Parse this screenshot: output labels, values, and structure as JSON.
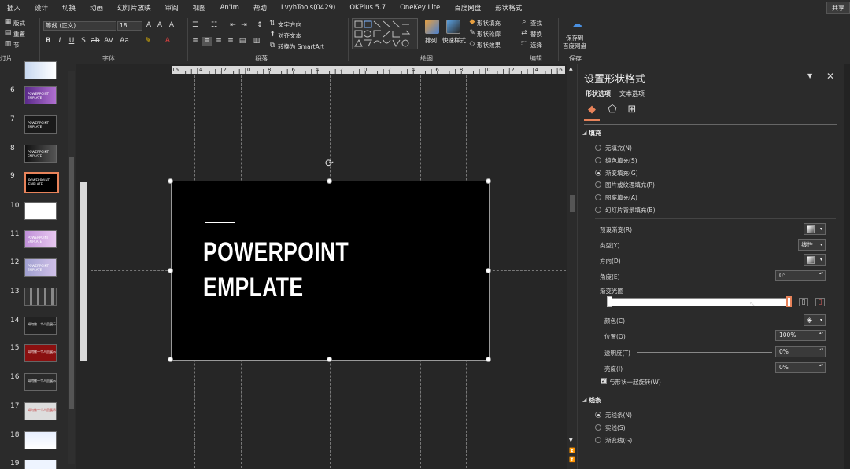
{
  "menu": {
    "items": [
      "插入",
      "设计",
      "切换",
      "动画",
      "幻灯片放映",
      "审阅",
      "视图",
      "An'Im",
      "帮助",
      "LvyhTools(0429)",
      "OKPlus 5.7",
      "OneKey Lite",
      "百度网盘",
      "形状格式"
    ],
    "share_label": "共享"
  },
  "ribbon": {
    "slides_group": {
      "layout_label": "版式",
      "reset_label": "重置",
      "section_label": "节",
      "group_label": "灯片"
    },
    "font_group": {
      "font_name": "等线 (正文)",
      "font_size": "18",
      "group_label": "字体"
    },
    "paragraph_group": {
      "text_direction_label": "文字方向",
      "align_text_label": "对齐文本",
      "smartart_label": "转换为 SmartArt",
      "group_label": "段落"
    },
    "drawing_group": {
      "arrange_label": "排列",
      "quick_styles_label": "快速样式",
      "shape_fill_label": "形状填充",
      "shape_outline_label": "形状轮廓",
      "shape_effects_label": "形状效果",
      "group_label": "绘图"
    },
    "editing_group": {
      "find_label": "查找",
      "replace_label": "替换",
      "select_label": "选择",
      "group_label": "编辑"
    },
    "save_group": {
      "save_label_line1": "保存到",
      "save_label_line2": "百度网盘",
      "group_label": "保存"
    }
  },
  "thumbnails": [
    {
      "number": "",
      "caption": "",
      "selected": false
    },
    {
      "number": "6",
      "caption": "POWERPOINT EMPLATE",
      "selected": false
    },
    {
      "number": "7",
      "caption": "POWERPOINT EMPLATE",
      "selected": false
    },
    {
      "number": "8",
      "caption": "POWERPOINT EMPLATE",
      "selected": false
    },
    {
      "number": "9",
      "caption": "POWERPOINT EMPLATE",
      "selected": true
    },
    {
      "number": "10",
      "caption": "",
      "selected": false
    },
    {
      "number": "11",
      "caption": "POWERPOINT EMPLATE",
      "selected": false
    },
    {
      "number": "12",
      "caption": "POWERPOINT EMPLATE",
      "selected": false
    },
    {
      "number": "13",
      "caption": "",
      "selected": false
    },
    {
      "number": "14",
      "caption": "如何做一个人员展示",
      "selected": false
    },
    {
      "number": "15",
      "caption": "如何做一个人员展示",
      "selected": false
    },
    {
      "number": "16",
      "caption": "如何做一个人员展示",
      "selected": false
    },
    {
      "number": "17",
      "caption": "如何做一个人员展示",
      "selected": false
    },
    {
      "number": "18",
      "caption": "",
      "selected": false
    },
    {
      "number": "19",
      "caption": "",
      "selected": false
    }
  ],
  "ruler": {
    "labels": [
      "16",
      "14",
      "12",
      "10",
      "8",
      "6",
      "4",
      "2",
      "0",
      "2",
      "4",
      "6",
      "8",
      "10",
      "12",
      "14",
      "16"
    ]
  },
  "slide": {
    "title_line1": "POWERPOINT",
    "title_line2": "EMPLATE"
  },
  "pane": {
    "title": "设置形状格式",
    "tabs": [
      "形状选项",
      "文本选项"
    ],
    "fill_section": {
      "heading": "填充",
      "options": [
        {
          "label": "无填充(N)",
          "checked": false
        },
        {
          "label": "纯色填充(S)",
          "checked": false
        },
        {
          "label": "渐变填充(G)",
          "checked": true
        },
        {
          "label": "图片或纹理填充(P)",
          "checked": false
        },
        {
          "label": "图案填充(A)",
          "checked": false
        },
        {
          "label": "幻灯片背景填充(B)",
          "checked": false
        }
      ],
      "preset_label": "预设渐变(R)",
      "type_label": "类型(Y)",
      "type_value": "线性",
      "direction_label": "方向(D)",
      "angle_label": "角度(E)",
      "angle_value": "0°",
      "stops_label": "渐变光圈",
      "color_label": "颜色(C)",
      "position_label": "位置(O)",
      "position_value": "100%",
      "transparency_label": "透明度(T)",
      "transparency_value": "0%",
      "brightness_label": "亮度(I)",
      "brightness_value": "0%",
      "rotate_label": "与形状一起旋转(W)",
      "rotate_checked": true
    },
    "line_section": {
      "heading": "线条",
      "options": [
        {
          "label": "无线条(N)",
          "checked": true
        },
        {
          "label": "实线(S)",
          "checked": false
        },
        {
          "label": "渐变线(G)",
          "checked": false
        }
      ]
    }
  }
}
